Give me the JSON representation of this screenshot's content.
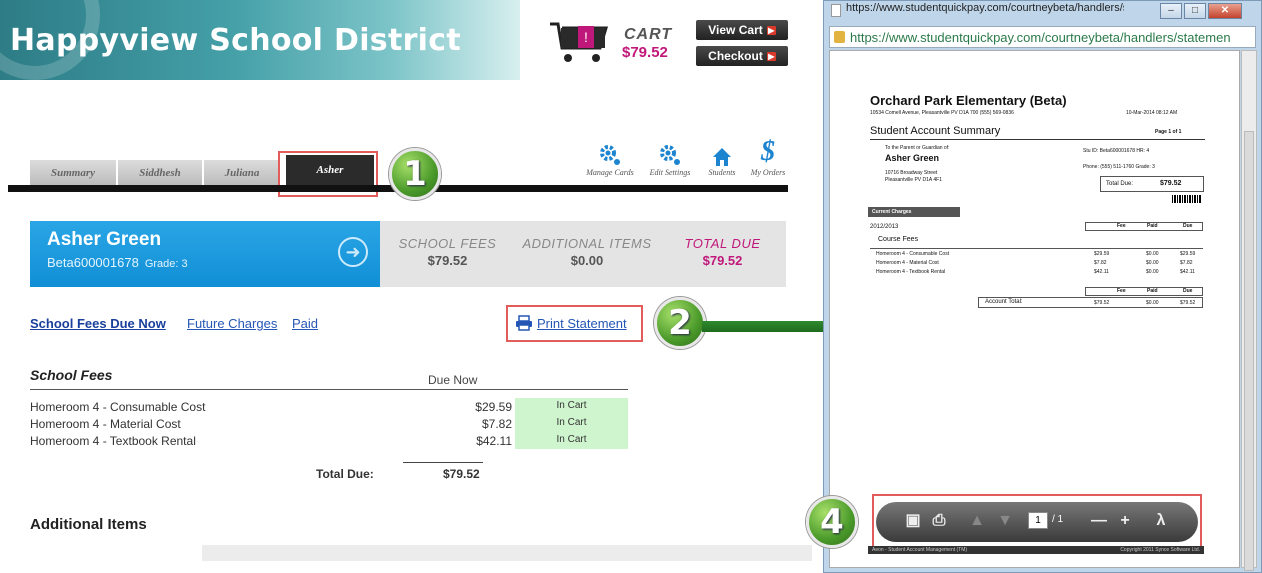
{
  "header": {
    "district_name": "Happyview School District",
    "cart_label": "CART",
    "cart_amount": "$79.52",
    "view_cart": "View Cart",
    "checkout": "Checkout"
  },
  "tabs": [
    "Summary",
    "Siddhesh",
    "Juliana",
    "Asher"
  ],
  "tools": [
    {
      "label": "Manage Cards",
      "icon": "gear-icon"
    },
    {
      "label": "Edit Settings",
      "icon": "gear-icon"
    },
    {
      "label": "Students",
      "icon": "home-icon"
    },
    {
      "label": "My Orders",
      "icon": "dollar-icon"
    }
  ],
  "badges": {
    "one": "1",
    "two": "2",
    "four": "4"
  },
  "student": {
    "name": "Asher Green",
    "id": "Beta600001678",
    "grade": "Grade: 3"
  },
  "summary": {
    "school_fees_label": "SCHOOL FEES",
    "school_fees": "$79.52",
    "additional_label": "ADDITIONAL ITEMS",
    "additional": "$0.00",
    "total_label": "TOTAL DUE",
    "total": "$79.52"
  },
  "links": {
    "due_now": "School Fees Due Now",
    "future": "Future Charges",
    "paid": "Paid",
    "print": "Print Statement"
  },
  "fees": {
    "heading": "School Fees",
    "col_due": "Due Now",
    "rows": [
      {
        "desc": "Homeroom 4 - Consumable Cost",
        "amount": "$29.59",
        "status": "In Cart"
      },
      {
        "desc": "Homeroom 4 - Material Cost",
        "amount": "$7.82",
        "status": "In Cart"
      },
      {
        "desc": "Homeroom 4 - Textbook Rental",
        "amount": "$42.11",
        "status": "In Cart"
      }
    ],
    "total_label": "Total Due:",
    "total": "$79.52"
  },
  "additional_heading": "Additional Items",
  "popup": {
    "title": "https://www.studentquickpay.com/courtneybeta/handlers/statement...",
    "url": "https://www.studentquickpay.com/courtneybeta/handlers/statemen",
    "doc": {
      "school": "Orchard Park Elementary (Beta)",
      "address": "10534 Comell Avenue, Pleasantville PV D1A 700 (555) 569-0836",
      "date": "10-Mar-2014 08:12 AM",
      "title": "Student Account Summary",
      "page": "Page 1 of 1",
      "to_parent": "To the Parent or Guardian of:",
      "student": "Asher Green",
      "street": "10716 Broadway Street",
      "city": "Pleasantville PV D1A 4F1",
      "stu_id": "Stu ID: Beta600001678 HR: 4",
      "phone": "Phone: (555) 511-1760 Grade: 3",
      "total_due_label": "Total Due:",
      "total_due": "$79.52",
      "current_charges": "Current Charges",
      "year": "2012/2013",
      "col_fee": "Fee",
      "col_paid": "Paid",
      "col_due": "Due",
      "course_fees": "Course Fees",
      "lines": [
        {
          "desc": "Homeroom 4 - Consumable Cost",
          "fee": "$29.59",
          "paid": "$0.00",
          "due": "$29.59"
        },
        {
          "desc": "Homeroom 4 - Material Cost",
          "fee": "$7.82",
          "paid": "$0.00",
          "due": "$7.82"
        },
        {
          "desc": "Homeroom 4 - Textbook Rental",
          "fee": "$42.11",
          "paid": "$0.00",
          "due": "$42.11"
        }
      ],
      "account_total_label": "Account Total:",
      "account_fee": "$79.52",
      "account_paid": "$0.00",
      "account_due": "$79.52",
      "footer_left": "Aeon - Student Account Management (TM)",
      "footer_right": "Copyright 2011 Synce Software Ltd."
    },
    "toolbar": {
      "page": "1",
      "of": "/ 1"
    }
  }
}
